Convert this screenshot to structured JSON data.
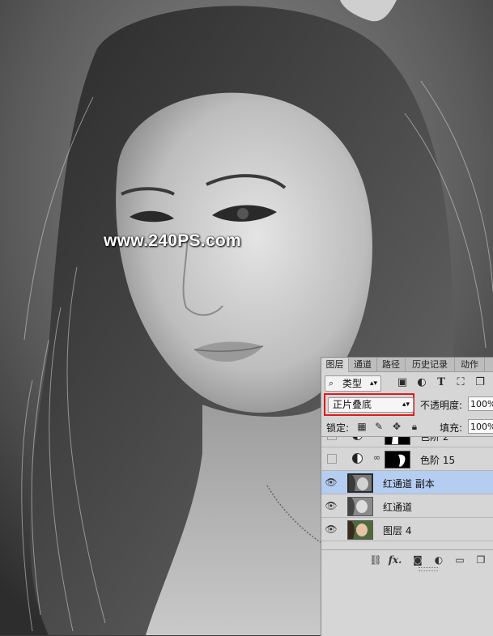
{
  "watermark": "www.240PS.com",
  "panel": {
    "tabs": [
      {
        "label": "图层",
        "active": true
      },
      {
        "label": "通道",
        "active": false
      },
      {
        "label": "路径",
        "active": false
      },
      {
        "label": "历史记录",
        "active": false
      },
      {
        "label": "动作",
        "active": false
      }
    ],
    "filter": {
      "kind_label": "类型",
      "icons": [
        "image-filter-icon",
        "adjustment-filter-icon",
        "type-filter-icon",
        "shape-filter-icon",
        "smart-object-filter-icon"
      ]
    },
    "blend_mode": "正片叠底",
    "opacity_label": "不透明度:",
    "opacity_value": "100%",
    "lock_label": "锁定:",
    "lock_icons": [
      "lock-transparent-icon",
      "lock-image-icon",
      "lock-position-icon",
      "lock-all-icon"
    ],
    "fill_label": "填充:",
    "fill_value": "100%",
    "layers": [
      {
        "name": "色阶 2",
        "visible": false,
        "type": "adjustment",
        "selected": false
      },
      {
        "name": "色阶 15",
        "visible": false,
        "type": "adjustment",
        "selected": false
      },
      {
        "name": "红通道 副本",
        "visible": true,
        "type": "pixel",
        "selected": true
      },
      {
        "name": "红通道",
        "visible": true,
        "type": "pixel",
        "selected": false
      },
      {
        "name": "图层 4",
        "visible": true,
        "type": "pixel-color",
        "selected": false
      }
    ],
    "bottom_icons": [
      "link-layers-icon",
      "fx-icon",
      "add-mask-icon",
      "new-adjustment-icon",
      "new-group-icon",
      "new-layer-icon"
    ],
    "fx_label": "fx."
  }
}
